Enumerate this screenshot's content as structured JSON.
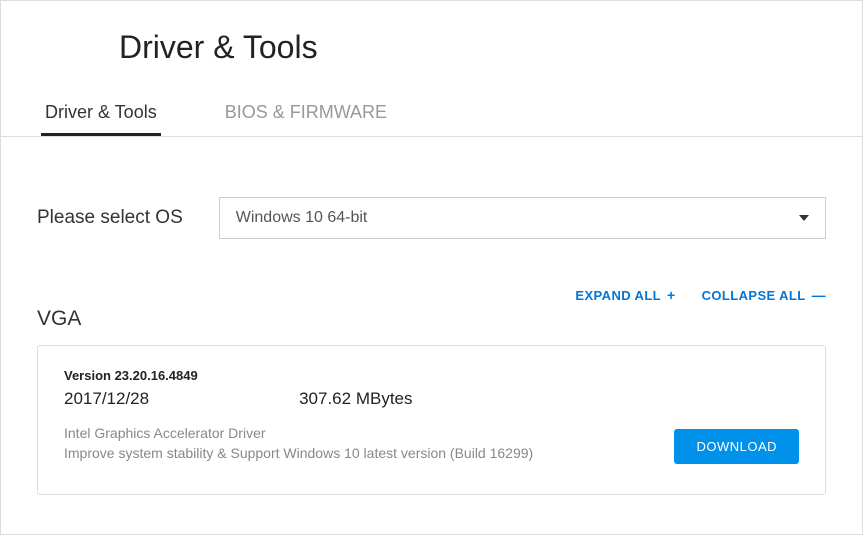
{
  "header": {
    "title": "Driver & Tools"
  },
  "tabs": [
    {
      "label": "Driver & Tools",
      "active": true
    },
    {
      "label": "BIOS & FIRMWARE",
      "active": false
    }
  ],
  "os": {
    "label": "Please select OS",
    "selected": "Windows 10 64-bit"
  },
  "actions": {
    "expand": "EXPAND ALL",
    "collapse": "COLLAPSE ALL"
  },
  "section": {
    "title": "VGA"
  },
  "driver": {
    "version_label": "Version 23.20.16.4849",
    "date": "2017/12/28",
    "size": "307.62 MBytes",
    "desc_line1": "Intel Graphics Accelerator Driver",
    "desc_line2": "Improve system stability & Support Windows 10 latest version (Build 16299)",
    "download_label": "DOWNLOAD"
  }
}
